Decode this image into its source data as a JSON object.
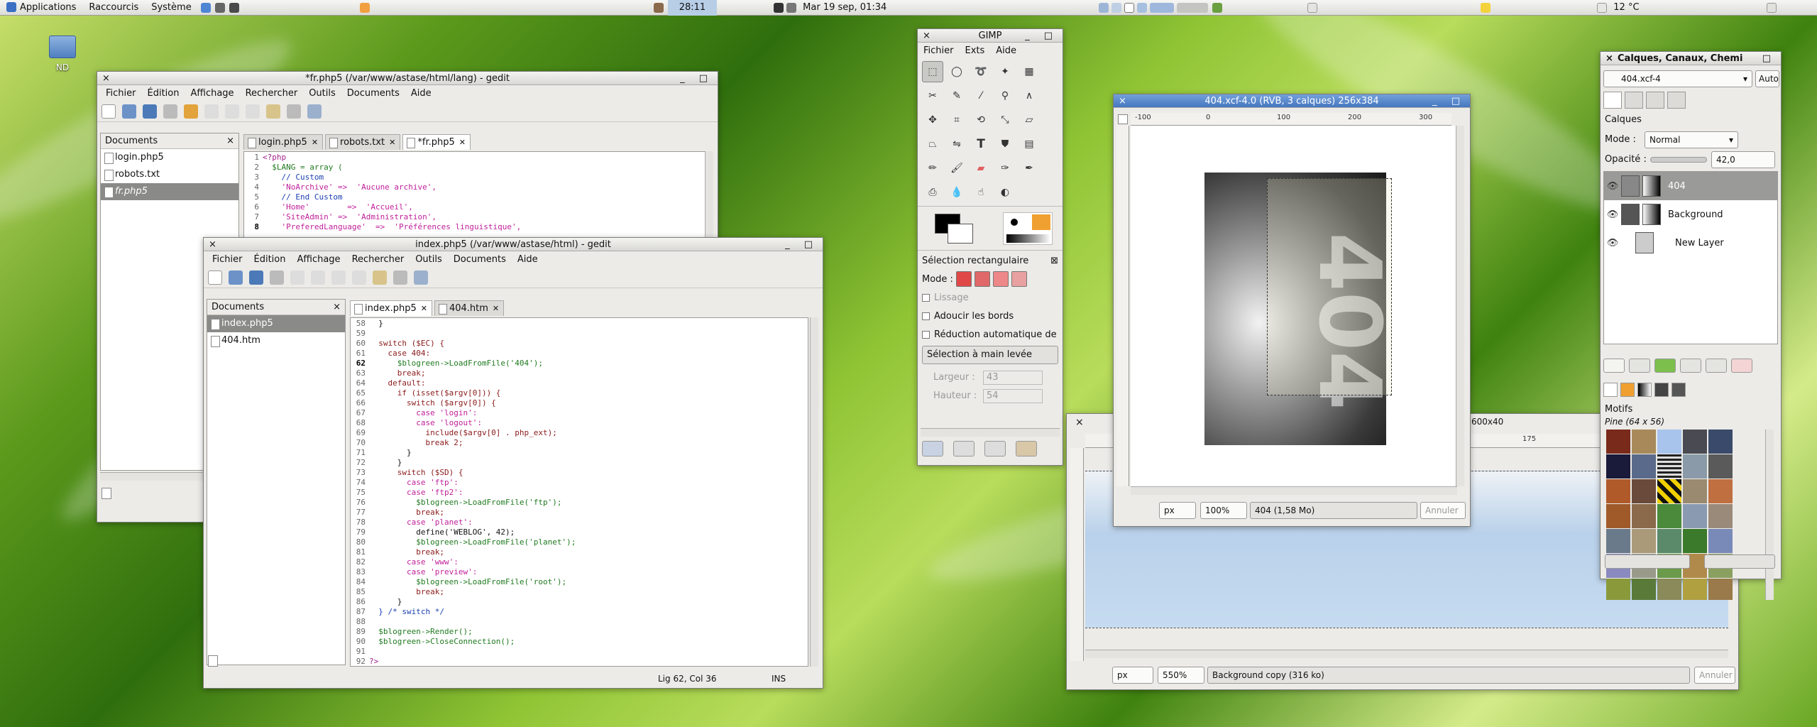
{
  "panel": {
    "applications": "Applications",
    "shortcuts": "Raccourcis",
    "system": "Système",
    "timer": "28:11",
    "datetime": "Mar 19 sep, 01:34",
    "weather": "12 °C"
  },
  "desktop": {
    "folder_label": "ND"
  },
  "gedit_fr": {
    "title": "*fr.php5 (/var/www/astase/html/lang) - gedit",
    "menu": [
      "Fichier",
      "Édition",
      "Affichage",
      "Rechercher",
      "Outils",
      "Documents",
      "Aide"
    ],
    "side_title": "Documents",
    "docs": [
      "login.php5",
      "robots.txt",
      "fr.php5"
    ],
    "tabs": [
      "login.php5",
      "robots.txt",
      "*fr.php5"
    ],
    "lines": [
      {
        "n": "1",
        "t": "<?php"
      },
      {
        "n": "2",
        "t": "  $LANG = array ("
      },
      {
        "n": "3",
        "t": "    // Custom"
      },
      {
        "n": "4",
        "t": "    'NoArchive' =>  'Aucune archive',"
      },
      {
        "n": "5",
        "t": "    // End Custom"
      },
      {
        "n": "6",
        "t": "    'Home'        =>  'Accueil',"
      },
      {
        "n": "7",
        "t": "    'SiteAdmin' =>  'Administration',"
      },
      {
        "n": "8",
        "t": "    'PreferedLanguage'  =>  'Préférences linguistique',"
      }
    ]
  },
  "gedit_index": {
    "title": "index.php5 (/var/www/astase/html) - gedit",
    "menu": [
      "Fichier",
      "Édition",
      "Affichage",
      "Rechercher",
      "Outils",
      "Documents",
      "Aide"
    ],
    "side_title": "Documents",
    "docs": [
      "index.php5",
      "404.htm"
    ],
    "tabs": [
      "index.php5",
      "404.htm"
    ],
    "lines": [
      {
        "n": "58",
        "t": "  }"
      },
      {
        "n": "59",
        "t": ""
      },
      {
        "n": "60",
        "t": "  switch ($EC) {"
      },
      {
        "n": "61",
        "t": "    case 404:"
      },
      {
        "n": "62",
        "t": "      $blogreen->LoadFromFile('404');"
      },
      {
        "n": "63",
        "t": "      break;"
      },
      {
        "n": "64",
        "t": "    default:"
      },
      {
        "n": "65",
        "t": "      if (isset($argv[0])) {"
      },
      {
        "n": "66",
        "t": "        switch ($argv[0]) {"
      },
      {
        "n": "67",
        "t": "          case 'login':"
      },
      {
        "n": "68",
        "t": "          case 'logout':"
      },
      {
        "n": "69",
        "t": "            include($argv[0] . php_ext);"
      },
      {
        "n": "70",
        "t": "            break 2;"
      },
      {
        "n": "71",
        "t": "        }"
      },
      {
        "n": "72",
        "t": "      }"
      },
      {
        "n": "73",
        "t": "      switch ($SD) {"
      },
      {
        "n": "74",
        "t": "        case 'ftp':"
      },
      {
        "n": "75",
        "t": "        case 'ftp2':"
      },
      {
        "n": "76",
        "t": "          $blogreen->LoadFromFile('ftp');"
      },
      {
        "n": "77",
        "t": "          break;"
      },
      {
        "n": "78",
        "t": "        case 'planet':"
      },
      {
        "n": "79",
        "t": "          define('WEBLOG', 42);"
      },
      {
        "n": "80",
        "t": "          $blogreen->LoadFromFile('planet');"
      },
      {
        "n": "81",
        "t": "          break;"
      },
      {
        "n": "82",
        "t": "        case 'www':"
      },
      {
        "n": "83",
        "t": "        case 'preview':"
      },
      {
        "n": "84",
        "t": "          $blogreen->LoadFromFile('root');"
      },
      {
        "n": "85",
        "t": "          break;"
      },
      {
        "n": "86",
        "t": "      }"
      },
      {
        "n": "87",
        "t": "  } /* switch */"
      },
      {
        "n": "88",
        "t": ""
      },
      {
        "n": "89",
        "t": "  $blogreen->Render();"
      },
      {
        "n": "90",
        "t": "  $blogreen->CloseConnection();"
      },
      {
        "n": "91",
        "t": ""
      },
      {
        "n": "92",
        "t": "?>"
      }
    ],
    "status_pos": "Lig 62, Col 36",
    "status_mode": "INS"
  },
  "gimp_toolbox": {
    "title": "GIMP",
    "menu": [
      "Fichier",
      "Exts",
      "Aide"
    ],
    "opts_title": "Sélection rectangulaire",
    "mode_label": "Mode :",
    "lissage": "Lissage",
    "adoucir": "Adoucir les bords",
    "reduction": "Réduction automatique de",
    "main_levee": "Sélection à main levée",
    "largeur_label": "Largeur :",
    "largeur_val": "43",
    "hauteur_label": "Hauteur :",
    "hauteur_val": "54"
  },
  "gimp_image": {
    "title": "404.xcf-4.0 (RVB, 3 calques) 256x384",
    "ruler_labels": [
      "-100",
      "0",
      "100",
      "200",
      "300"
    ],
    "unit": "px",
    "zoom": "100%",
    "info": "404 (1,58 Mo)",
    "cancel": "Annuler",
    "art_text": "404"
  },
  "gimp_image2": {
    "size_label": "600x40",
    "ruler_label": "175",
    "unit": "px",
    "zoom": "550%",
    "info": "Background copy (316 ko)",
    "cancel": "Annuler"
  },
  "layers_dock": {
    "title": "Calques, Canaux, Chemi",
    "image_select": "404.xcf-4",
    "auto": "Auto",
    "section": "Calques",
    "mode_label": "Mode :",
    "mode_value": "Normal",
    "opacity_label": "Opacité :",
    "opacity_value": "42,0",
    "layers": [
      "404",
      "Background",
      "New Layer"
    ],
    "patterns_title": "Motifs",
    "pattern_name": "Pine (64 x 56)"
  }
}
